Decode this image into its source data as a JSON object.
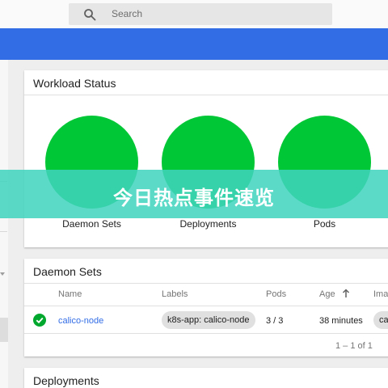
{
  "search": {
    "placeholder": "Search",
    "icon": "search-icon"
  },
  "colors": {
    "accent": "#326de6",
    "success": "#00c736",
    "banner": "#40d4be"
  },
  "workload_status": {
    "title": "Workload Status",
    "items": [
      {
        "label": "Daemon Sets",
        "status": "running"
      },
      {
        "label": "Deployments",
        "status": "running"
      },
      {
        "label": "Pods",
        "status": "running"
      }
    ]
  },
  "daemon_sets": {
    "title": "Daemon Sets",
    "columns": [
      "Name",
      "Labels",
      "Pods",
      "Age",
      "Ima"
    ],
    "sort_icon": "arrow-up-icon",
    "rows": [
      {
        "status": "success",
        "name": "calico-node",
        "label": "k8s-app: calico-node",
        "pods": "3 / 3",
        "age": "38 minutes",
        "image_chip": "calico"
      }
    ],
    "pagination": "1 – 1 of 1"
  },
  "deployments": {
    "title": "Deployments"
  },
  "banner": {
    "text": "今日热点事件速览"
  }
}
